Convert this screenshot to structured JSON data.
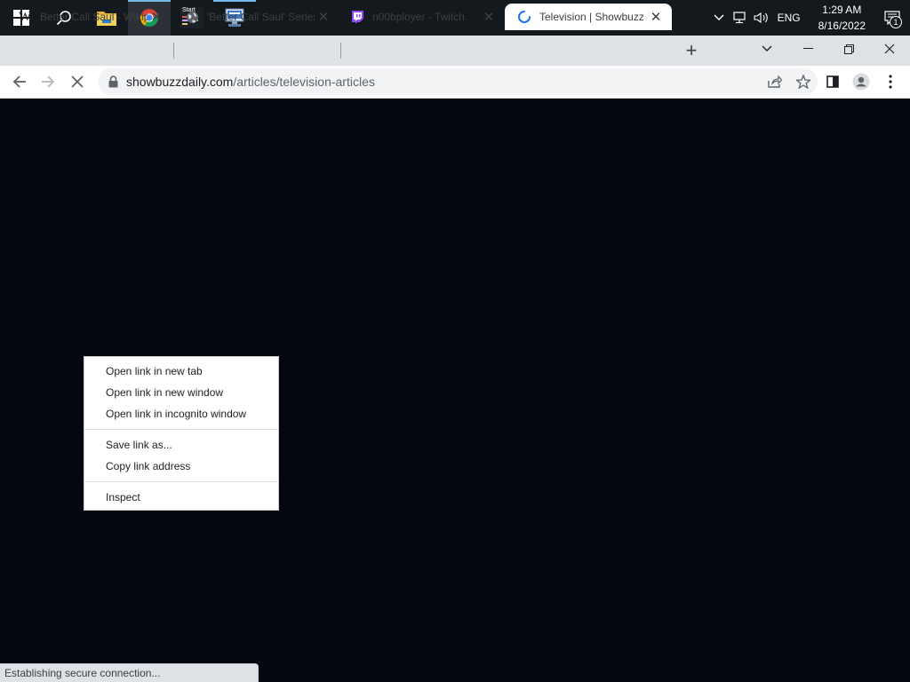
{
  "taskbar": {
    "start_icon": "windows-logo-icon",
    "search_icon": "search-icon",
    "apps": [
      {
        "name": "File Explorer",
        "icon": "folder-icon"
      },
      {
        "name": "Google Chrome",
        "icon": "chrome-icon"
      },
      {
        "name": "Start",
        "icon": "start-app-icon",
        "label": "Start"
      },
      {
        "name": "Network app",
        "icon": "network-app-icon"
      }
    ],
    "tray": {
      "language": "ENG",
      "time": "1:29 AM",
      "date": "8/16/2022",
      "notification_count": "1"
    }
  },
  "browser": {
    "tabs": [
      {
        "title": "Better Call Saul - Wikipedia",
        "favicon": "wikipedia-icon",
        "favicon_letter": "W"
      },
      {
        "title": "'Better Call Saul' Series Finale",
        "favicon": "globe-icon"
      },
      {
        "title": "n00bployer - Twitch",
        "favicon": "twitch-icon"
      },
      {
        "title": "Television | Showbuzz Daily",
        "favicon": "loading-spinner-icon"
      }
    ],
    "new_tab_label": "+",
    "address": {
      "host": "showbuzzdaily.com",
      "path": "/articles/television-articles"
    }
  },
  "context_menu": {
    "group1": [
      "Open link in new tab",
      "Open link in new window",
      "Open link in incognito window"
    ],
    "group2": [
      "Save link as...",
      "Copy link address"
    ],
    "group3": [
      "Inspect"
    ]
  },
  "status_bar": {
    "text": "Establishing secure connection..."
  },
  "colors": {
    "taskbar": "#14191d",
    "tabstrip": "#dee1e6",
    "page_background": "#04070f",
    "accent": "#76b9ed"
  }
}
